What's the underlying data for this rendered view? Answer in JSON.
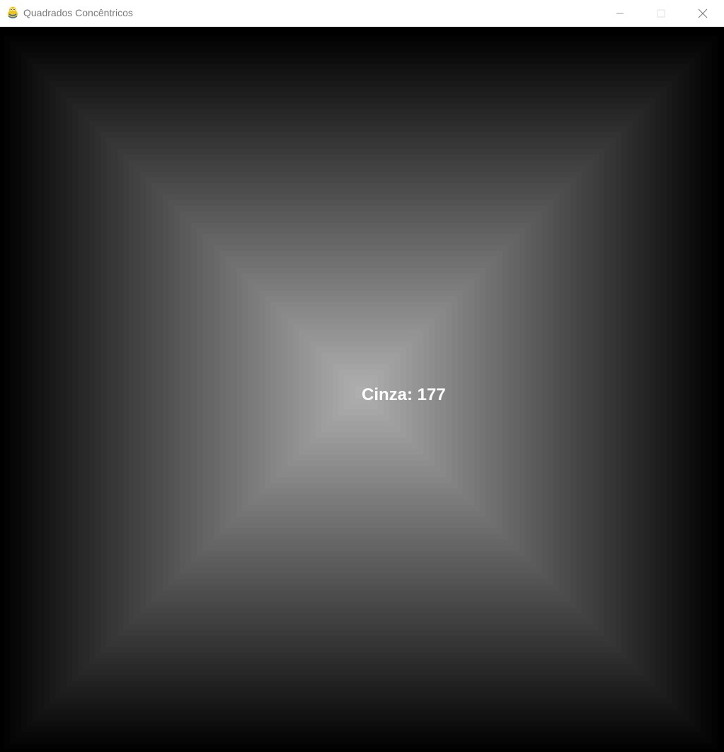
{
  "window": {
    "title": "Quadrados Concêntricos",
    "app_icon": "pygame-snake-icon",
    "controls": {
      "minimize_icon": "minimize-icon",
      "maximize_icon": "maximize-icon",
      "close_icon": "close-icon"
    }
  },
  "canvas": {
    "label_prefix": "Cinza:",
    "gray_value": 177,
    "label": "Cinza: 177",
    "background_color": "#000000",
    "label_color": "#ffffff",
    "max_gray": 177,
    "min_gray": 0
  }
}
